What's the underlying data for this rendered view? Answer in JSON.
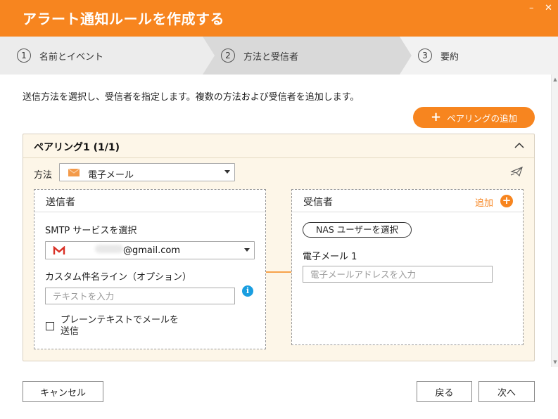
{
  "window": {
    "title": "アラート通知ルールを作成する",
    "minimize": "–",
    "close": "✕"
  },
  "steps": [
    {
      "number": "1",
      "label": "名前とイベント",
      "active": false
    },
    {
      "number": "2",
      "label": "方法と受信者",
      "active": true
    },
    {
      "number": "3",
      "label": "要約",
      "active": false
    }
  ],
  "description": "送信方法を選択し、受信者を指定します。複数の方法および受信者を追加します。",
  "add_pairing_label": "ペアリングの追加",
  "pairing": {
    "title": "ペアリング1 (1/1)",
    "method_label": "方法",
    "method_value": "電子メール",
    "sender": {
      "title": "送信者",
      "smtp_label": "SMTP サービスを選択",
      "smtp_value": "@gmail.com",
      "subject_label": "カスタム件名ライン（オプション）",
      "subject_placeholder": "テキストを入力",
      "plaintext_label": "プレーンテキストでメールを送信",
      "plaintext_checked": false
    },
    "receiver": {
      "title": "受信者",
      "add_label": "追加",
      "nas_button": "NAS ユーザーを選択",
      "email_label": "電子メール 1",
      "email_placeholder": "電子メールアドレスを入力"
    }
  },
  "footer": {
    "cancel": "キャンセル",
    "back": "戻る",
    "next": "次へ"
  },
  "colors": {
    "accent": "#f7851f",
    "info": "#1a9ee0",
    "pairing_bg": "#fdf6e8"
  }
}
